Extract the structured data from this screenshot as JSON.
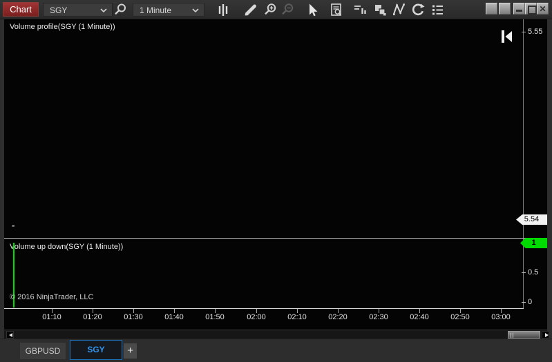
{
  "toolbar": {
    "chart_label": "Chart",
    "instrument_value": "SGY",
    "interval_value": "1 Minute",
    "icons": [
      "search",
      "chart-style-bars",
      "drawing-pencil",
      "zoom-in",
      "zoom-out-disabled",
      "cursor-pointer",
      "data-box",
      "chart-panels",
      "bring-to-front-layers",
      "zigzag-line",
      "reload",
      "properties-list"
    ],
    "window_controls": [
      "blank-square-1",
      "blank-square-2",
      "minimize",
      "restore",
      "close"
    ]
  },
  "upper_panel": {
    "label": "Volume profile(SGY (1 Minute))",
    "tick_top": "5.55",
    "price_marker": "5.54",
    "last_dash": "-",
    "jump_icon": "go-to-last-bar"
  },
  "lower_panel": {
    "label": "Volume up down(SGY (1 Minute))",
    "copyright": "© 2016 NinjaTrader, LLC",
    "tick_mid": "0.5",
    "tick_zero": "0",
    "marker_value": "1"
  },
  "time_axis": {
    "labels": [
      "01:10",
      "01:20",
      "01:30",
      "01:40",
      "01:50",
      "02:00",
      "02:10",
      "02:20",
      "02:30",
      "02:40",
      "02:50",
      "03:00"
    ]
  },
  "tabs": {
    "items": [
      {
        "label": "GBPUSD",
        "active": false
      },
      {
        "label": "SGY",
        "active": true
      }
    ],
    "add_label": "+"
  },
  "chart_data": [
    {
      "type": "bar",
      "panel": "Volume up down(SGY (1 Minute))",
      "x": [
        "01:05"
      ],
      "values": [
        1
      ],
      "bar_color": "#00e000",
      "ylim": [
        0,
        1
      ],
      "yticks": [
        0,
        0.5,
        1
      ],
      "current_value_marker": 1
    },
    {
      "type": "profile",
      "panel": "Volume profile(SGY (1 Minute))",
      "visible_bars": [],
      "last_price_marker": 5.54,
      "yticks": [
        5.55
      ],
      "xrange": [
        "01:10",
        "03:00"
      ]
    }
  ],
  "colors": {
    "chart_button_red": "#8e2626",
    "accent_blue": "#2f93ef",
    "marker_green": "#00dc00",
    "price_tag_white": "#f2f2f2",
    "background_black": "#040404",
    "frame_gray": "#2e2e2e"
  }
}
